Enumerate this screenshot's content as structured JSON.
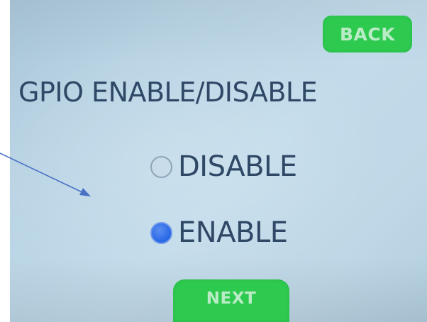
{
  "header": {
    "back_label": "BACK"
  },
  "main": {
    "title": "GPIO ENABLE/DISABLE",
    "options": [
      {
        "label": "DISABLE",
        "selected": false
      },
      {
        "label": "ENABLE",
        "selected": true
      }
    ]
  },
  "footer": {
    "next_label": "NEXT"
  },
  "colors": {
    "button_green": "#2ec94f",
    "button_text": "#b9ecc6",
    "text_navy": "#2f4866",
    "radio_selected": "#2766e4",
    "screen_bg": "#bcd6e6",
    "annotation_arrow": "#4a72c4"
  }
}
